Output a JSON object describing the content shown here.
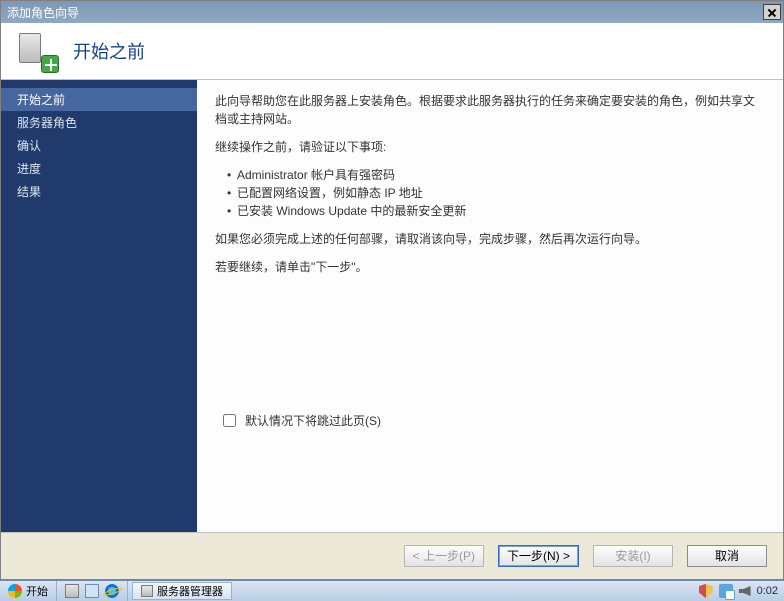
{
  "window": {
    "title": "添加角色向导"
  },
  "header": {
    "title": "开始之前"
  },
  "sidebar": {
    "items": [
      {
        "label": "开始之前",
        "active": true
      },
      {
        "label": "服务器角色",
        "active": false
      },
      {
        "label": "确认",
        "active": false
      },
      {
        "label": "进度",
        "active": false
      },
      {
        "label": "结果",
        "active": false
      }
    ]
  },
  "content": {
    "intro": "此向导帮助您在此服务器上安装角色。根据要求此服务器执行的任务来确定要安装的角色，例如共享文档或主持网站。",
    "verify_heading": "继续操作之前，请验证以下事项:",
    "checks": [
      "Administrator 帐户具有强密码",
      "已配置网络设置，例如静态 IP 地址",
      "已安装 Windows Update 中的最新安全更新"
    ],
    "if_incomplete": "如果您必须完成上述的任何部骤，请取消该向导，完成步骤，然后再次运行向导。",
    "to_continue": "若要继续，请单击\"下一步\"。",
    "skip_label": "默认情况下将跳过此页(S)"
  },
  "buttons": {
    "prev": "< 上一步(P)",
    "next": "下一步(N) >",
    "install": "安装(I)",
    "cancel": "取消"
  },
  "taskbar": {
    "start": "开始",
    "task1": "服务器管理器",
    "clock": "0:02"
  }
}
